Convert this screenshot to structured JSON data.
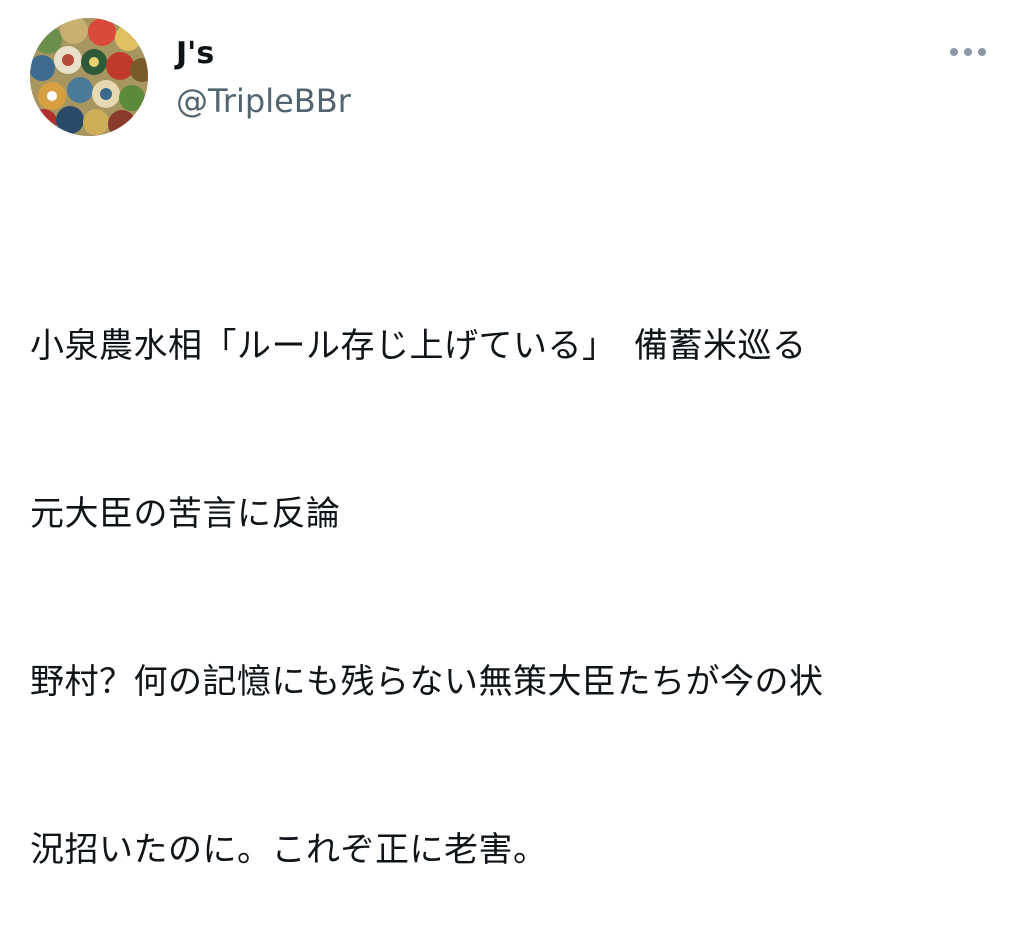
{
  "tweet": {
    "avatar_icon": "bottle-caps-avatar",
    "display_name": "J's",
    "handle": "@TripleBBr",
    "more_icon": "more-dots-icon",
    "text_lines": [
      "小泉農水相「ルール存じ上げている」　備蓄米巡る",
      "元大臣の苦言に反論",
      "野村？何の記憶にも残らない無策大臣たちが今の状",
      "況招いたのに。これぞ正に老害。"
    ]
  },
  "colors": {
    "text_primary": "#0f1419",
    "text_secondary": "#536471",
    "icon": "#8b98a5",
    "background": "#ffffff"
  }
}
